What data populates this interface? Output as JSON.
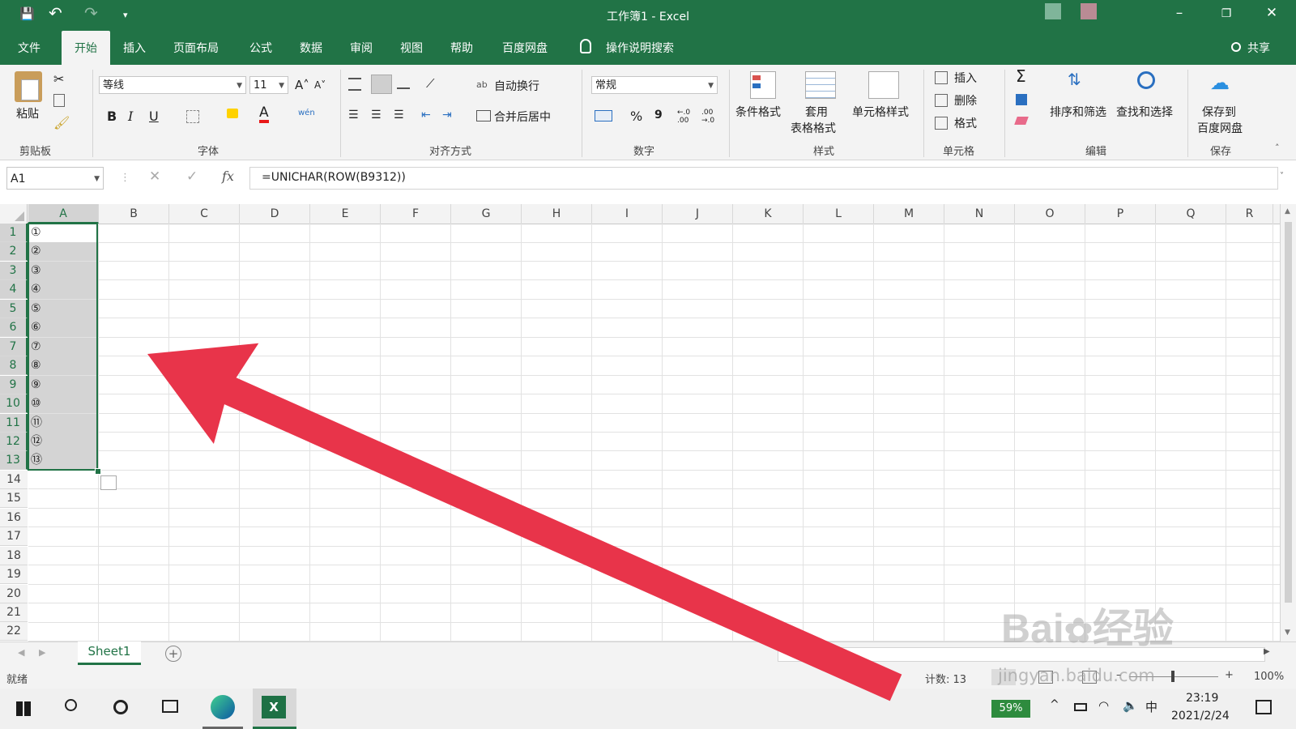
{
  "window": {
    "title": "工作簿1  -  Excel",
    "minimize": "–",
    "restore": "❐",
    "close": "✕"
  },
  "qat": {
    "save": "💾",
    "undo": "↶",
    "redo": "↷",
    "customize": "▾"
  },
  "menu": {
    "tabs": [
      {
        "label": "文件"
      },
      {
        "label": "开始"
      },
      {
        "label": "插入"
      },
      {
        "label": "页面布局"
      },
      {
        "label": "公式"
      },
      {
        "label": "数据"
      },
      {
        "label": "审阅"
      },
      {
        "label": "视图"
      },
      {
        "label": "帮助"
      },
      {
        "label": "百度网盘"
      }
    ],
    "tellme": "操作说明搜索",
    "share": "共享"
  },
  "ribbon": {
    "clipboard": {
      "paste": "粘贴",
      "group": "剪贴板"
    },
    "font": {
      "name": "等线",
      "size": "11",
      "grow": "A˄",
      "shrink": "A˅",
      "bold": "B",
      "italic": "I",
      "underline": "U",
      "color_letter": "A",
      "phonetic": "wén",
      "group": "字体"
    },
    "alignment": {
      "wrap": "自动换行",
      "merge": "合并后居中",
      "group": "对齐方式"
    },
    "number": {
      "format": "常规",
      "percent": "%",
      "comma": "9",
      "inc_decimal": "←.0 .00",
      "dec_decimal": ".00 →.0",
      "group": "数字"
    },
    "styles": {
      "conditional": "条件格式",
      "table_line1": "套用",
      "table_line2": "表格格式",
      "cell_styles": "单元格样式",
      "group": "样式"
    },
    "cells": {
      "insert": "插入",
      "delete": "删除",
      "format": "格式",
      "group": "单元格"
    },
    "editing": {
      "autosum": "Σ",
      "sort": "排序和筛选",
      "find": "查找和选择",
      "group": "编辑"
    },
    "save": {
      "line1": "保存到",
      "line2": "百度网盘",
      "group": "保存"
    }
  },
  "formula_bar": {
    "name_box": "A1",
    "cancel": "✕",
    "enter": "✓",
    "fx": "fx",
    "formula": "=UNICHAR(ROW(B9312))"
  },
  "grid": {
    "columns": [
      "A",
      "B",
      "C",
      "D",
      "E",
      "F",
      "G",
      "H",
      "I",
      "J",
      "K",
      "L",
      "M",
      "N",
      "O",
      "P",
      "Q",
      "R"
    ],
    "rows": [
      "1",
      "2",
      "3",
      "4",
      "5",
      "6",
      "7",
      "8",
      "9",
      "10",
      "11",
      "12",
      "13",
      "14",
      "15",
      "16",
      "17",
      "18",
      "19",
      "20",
      "21",
      "22"
    ],
    "column_a_values": [
      "①",
      "②",
      "③",
      "④",
      "⑤",
      "⑥",
      "⑦",
      "⑧",
      "⑨",
      "⑩",
      "⑪",
      "⑫",
      "⑬"
    ],
    "selection_color": "#d4d4d4",
    "selection_border": "#217346"
  },
  "sheets": {
    "active": "Sheet1",
    "add": "+"
  },
  "status": {
    "ready": "就绪",
    "count": "计数: 13",
    "zoom": "100%"
  },
  "taskbar": {
    "battery": "59%",
    "ime": "中",
    "time": "23:19",
    "date": "2021/2/24"
  },
  "watermark": {
    "brand": "Bai",
    "brand_cn": "经验",
    "url": "jingyan.baidu.com"
  },
  "annotation": {
    "arrow_color": "#e8344a"
  }
}
